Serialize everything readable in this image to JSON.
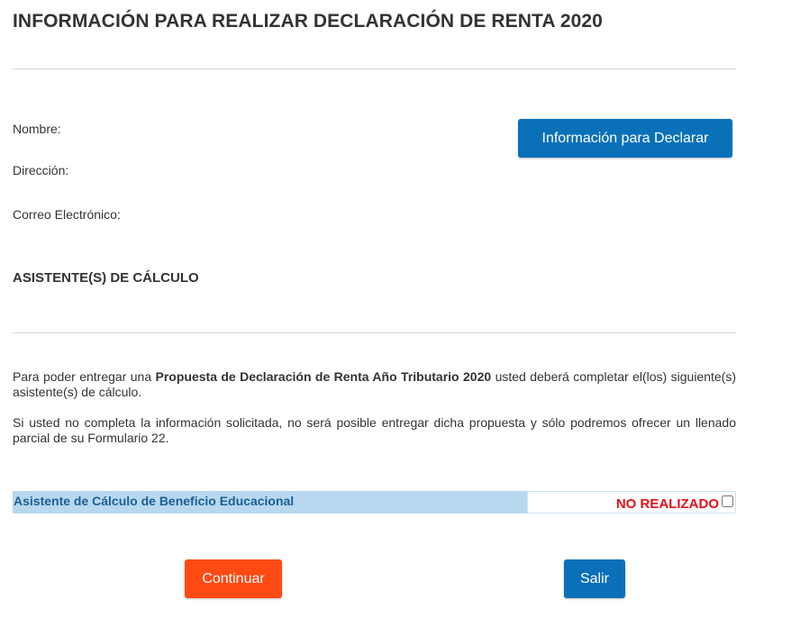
{
  "page": {
    "title": "INFORMACIÓN PARA REALIZAR DECLARACIÓN DE RENTA 2020"
  },
  "fields": {
    "name_label": "Nombre:",
    "address_label": "Dirección:",
    "email_label": "Correo Electrónico:"
  },
  "buttons": {
    "info_label": "Información para Declarar",
    "continue_label": "Continuar",
    "exit_label": "Salir"
  },
  "section": {
    "title": "ASISTENTE(S) DE CÁLCULO"
  },
  "paragraphs": {
    "p1_before": "Para poder entregar una ",
    "p1_bold": "Propuesta de Declaración de Renta Año Tributario 2020",
    "p1_after": " usted deberá completar el(los) siguiente(s) asistente(s) de cálculo.",
    "p2": "Si usted no completa la información solicitada, no será posible entregar dicha propuesta y sólo podremos ofrecer un llenado parcial de su Formulario 22."
  },
  "assistants": [
    {
      "name": "Asistente de Cálculo de Beneficio Educacional",
      "status": "NO REALIZADO",
      "checked": false
    }
  ],
  "colors": {
    "primary_button": "#0a71b8",
    "continue_button": "#ff4a14",
    "assistant_row_bg": "#b8d8f0",
    "assistant_text": "#1b5f95",
    "status_red": "#e3101b"
  }
}
